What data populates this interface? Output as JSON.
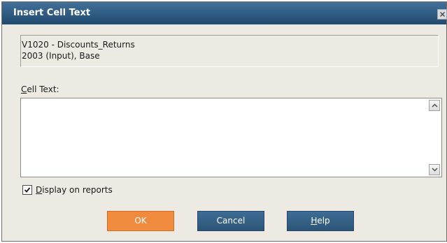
{
  "window": {
    "title": "Insert Cell Text",
    "close_icon": "close-icon"
  },
  "info": {
    "line1": "V1020 - Discounts_Returns",
    "line2": "2003 (Input), Base"
  },
  "cell_text": {
    "label_prefix": "C",
    "label_rest": "ell Text:",
    "value": ""
  },
  "display_on_reports": {
    "checked": true,
    "label_prefix": "D",
    "label_rest": "isplay on reports"
  },
  "buttons": {
    "ok": "OK",
    "cancel": "Cancel",
    "help_prefix": "H",
    "help_rest": "elp"
  },
  "colors": {
    "titlebar": "#2f5b82",
    "ok_button": "#f08a3c",
    "secondary_button": "#345f84",
    "dialog_background": "#eceae3"
  }
}
